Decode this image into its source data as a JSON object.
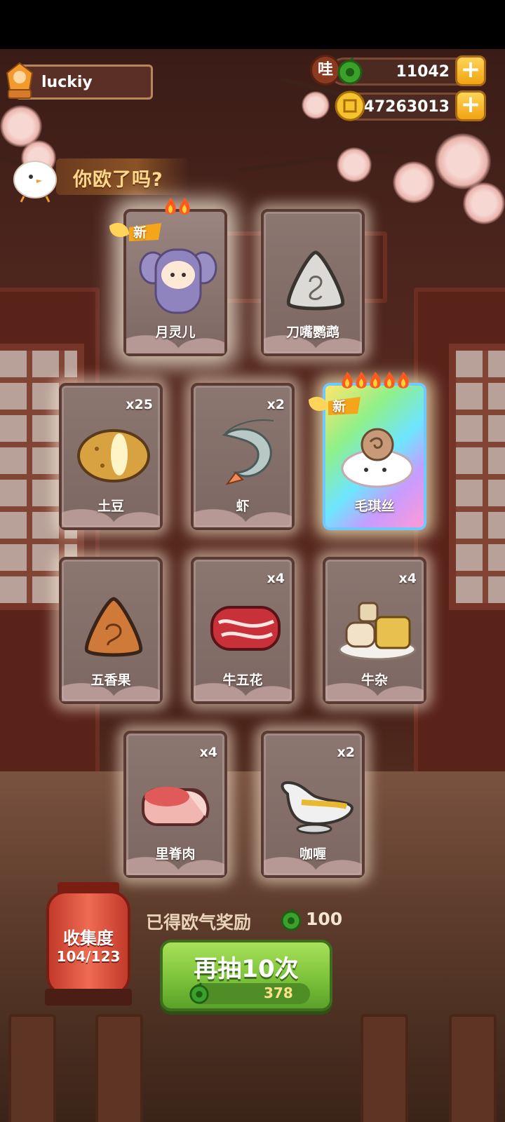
{
  "player": {
    "name": "luckiy"
  },
  "resources": {
    "gems": {
      "icon": "wa-token-icon",
      "value": "11042",
      "badge": "哇"
    },
    "gold": {
      "icon": "gold-coin-icon",
      "value": "47263013"
    }
  },
  "banner": {
    "text": "你欧了吗?"
  },
  "new_tag": "新",
  "cards": [
    {
      "name": "月灵儿",
      "count": "",
      "art": "elephant-costume-character-icon",
      "flames": 2,
      "is_new": true,
      "rarity": "highlight"
    },
    {
      "name": "刀嘴鹦鹉",
      "count": "",
      "art": "spiral-triangle-icon",
      "flames": 0,
      "is_new": false,
      "rarity": "normal"
    },
    {
      "name": "土豆",
      "count": "x25",
      "art": "potato-icon",
      "flames": 0,
      "is_new": false,
      "rarity": "normal"
    },
    {
      "name": "虾",
      "count": "x2",
      "art": "shrimp-icon",
      "flames": 0,
      "is_new": false,
      "rarity": "normal"
    },
    {
      "name": "毛琪丝",
      "count": "",
      "art": "hermit-cat-character-icon",
      "flames": 5,
      "is_new": true,
      "rarity": "rainbow"
    },
    {
      "name": "五香果",
      "count": "",
      "art": "spiced-fruit-icon",
      "flames": 0,
      "is_new": false,
      "rarity": "normal"
    },
    {
      "name": "牛五花",
      "count": "x4",
      "art": "beef-belly-icon",
      "flames": 0,
      "is_new": false,
      "rarity": "normal"
    },
    {
      "name": "牛杂",
      "count": "x4",
      "art": "beef-offal-icon",
      "flames": 0,
      "is_new": false,
      "rarity": "normal"
    },
    {
      "name": "里脊肉",
      "count": "x4",
      "art": "tenderloin-icon",
      "flames": 0,
      "is_new": false,
      "rarity": "normal"
    },
    {
      "name": "咖喱",
      "count": "x2",
      "art": "curry-boat-icon",
      "flames": 0,
      "is_new": false,
      "rarity": "normal"
    }
  ],
  "collection": {
    "title": "收集度",
    "value": "104/123"
  },
  "reward": {
    "label": "已得欧气奖励",
    "value": "100",
    "icon": "green-token-icon"
  },
  "draw_button": {
    "label": "再抽10次",
    "cost": "378",
    "cost_icon": "green-token-icon"
  },
  "colors": {
    "rainbow_border": "#6fc8ff",
    "button_green": "#7cc23a",
    "gold": "#f2a312"
  }
}
